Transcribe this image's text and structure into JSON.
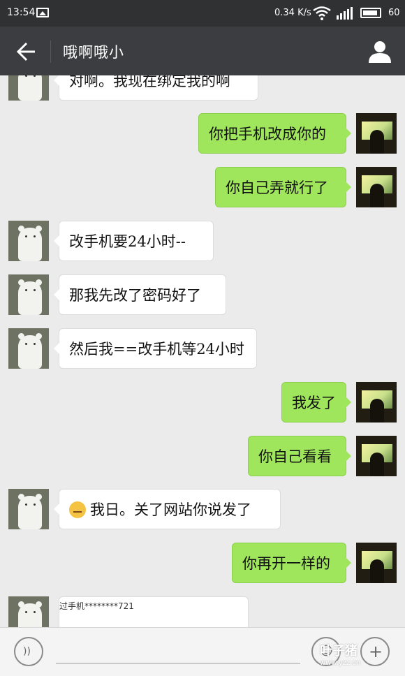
{
  "status_bar": {
    "time": "13:54",
    "net_speed": "0.34 K/s",
    "battery": "60"
  },
  "header": {
    "title": "哦啊哦小"
  },
  "messages": [
    {
      "side": "left",
      "text": "对啊。我现在绑定我的啊"
    },
    {
      "side": "right",
      "text": "你把手机改成你的"
    },
    {
      "side": "right",
      "text": "你自己弄就行了"
    },
    {
      "side": "left",
      "text": "改手机要24小时--"
    },
    {
      "side": "left",
      "text": "那我先改了密码好了"
    },
    {
      "side": "left",
      "text": "然后我==改手机等24小时"
    },
    {
      "side": "right",
      "text": "我发了"
    },
    {
      "side": "right",
      "text": "你自己看看"
    },
    {
      "side": "left",
      "text": "我日。关了网站你说发了"
    },
    {
      "side": "right",
      "text": "你再开一样的"
    }
  ],
  "sms_card": {
    "line1": "过手机********721"
  },
  "watermark": {
    "main": "叶子猪",
    "sub": "www.yzz.cn"
  },
  "colors": {
    "title_bar": "#3b3d40",
    "sent_bubble": "#9fe65c",
    "received_bubble": "#ffffff",
    "chat_bg": "#ebebeb"
  }
}
